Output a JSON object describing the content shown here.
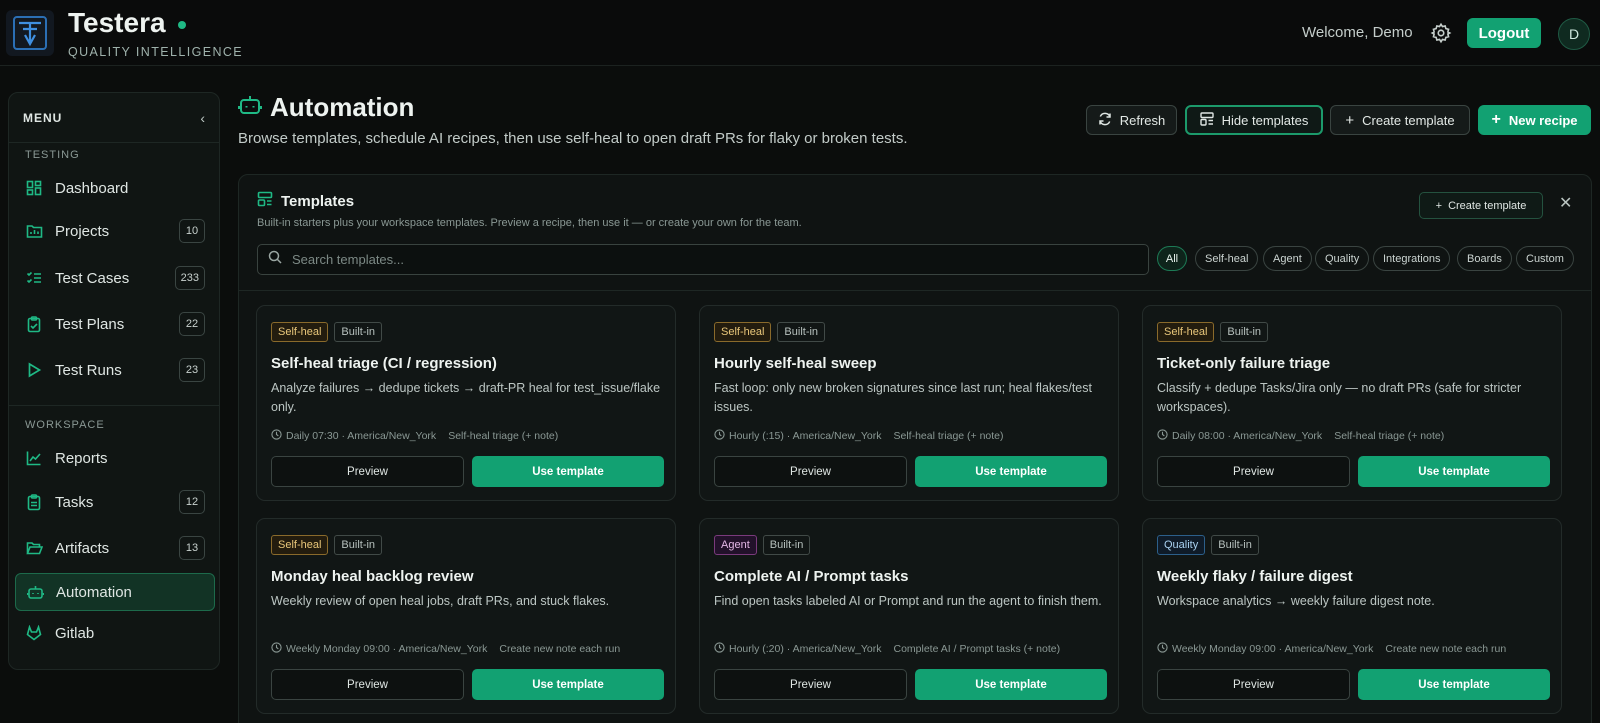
{
  "brand": {
    "name": "Testera",
    "subtitle": "QUALITY INTELLIGENCE"
  },
  "header": {
    "welcome": "Welcome, Demo",
    "logout": "Logout",
    "avatar": "D"
  },
  "sidebar": {
    "menu_label": "MENU",
    "sections": [
      {
        "label": "TESTING"
      },
      {
        "label": "WORKSPACE"
      }
    ],
    "items": [
      {
        "label": "Dashboard",
        "icon": "dashboard-icon"
      },
      {
        "label": "Projects",
        "count": "10",
        "icon": "folder-chart-icon"
      },
      {
        "label": "Test Cases",
        "count": "233",
        "icon": "list-check-icon"
      },
      {
        "label": "Test Plans",
        "count": "22",
        "icon": "clipboard-check-icon"
      },
      {
        "label": "Test Runs",
        "count": "23",
        "icon": "play-icon"
      },
      {
        "label": "Reports",
        "icon": "line-chart-icon"
      },
      {
        "label": "Tasks",
        "count": "12",
        "icon": "clipboard-icon"
      },
      {
        "label": "Artifacts",
        "count": "13",
        "icon": "folder-open-icon"
      },
      {
        "label": "Automation",
        "icon": "bot-icon",
        "active": true
      },
      {
        "label": "Gitlab",
        "icon": "gitlab-icon"
      }
    ]
  },
  "page": {
    "title": "Automation",
    "description": "Browse templates, schedule AI recipes, then use self-heal to open draft PRs for flaky or broken tests.",
    "actions": {
      "refresh": "Refresh",
      "hide_templates": "Hide templates",
      "create_template": "Create template",
      "new_recipe": "New recipe"
    }
  },
  "templates": {
    "title": "Templates",
    "description": "Built-in starters plus your workspace templates. Preview a recipe, then use it — or create your own for the team.",
    "create_button": "Create template",
    "search_placeholder": "Search templates...",
    "filters": [
      "All",
      "Self-heal",
      "Agent",
      "Quality",
      "Integrations",
      "Boards",
      "Custom"
    ],
    "active_filter": "All",
    "preview_label": "Preview",
    "use_label": "Use template",
    "cards": [
      {
        "category": "Self-heal",
        "origin": "Built-in",
        "title": "Self-heal triage (CI / regression)",
        "description": "Analyze failures → dedupe tickets → draft-PR heal for test_issue/flake only.",
        "schedule": "Daily 07:30 · America/New_York",
        "output": "Self-heal triage (+ note)"
      },
      {
        "category": "Self-heal",
        "origin": "Built-in",
        "title": "Hourly self-heal sweep",
        "description": "Fast loop: only new broken signatures since last run; heal flakes/test issues.",
        "schedule": "Hourly (:15) · America/New_York",
        "output": "Self-heal triage (+ note)"
      },
      {
        "category": "Self-heal",
        "origin": "Built-in",
        "title": "Ticket-only failure triage",
        "description": "Classify + dedupe Tasks/Jira only — no draft PRs (safe for stricter workspaces).",
        "schedule": "Daily 08:00 · America/New_York",
        "output": "Self-heal triage (+ note)"
      },
      {
        "category": "Self-heal",
        "origin": "Built-in",
        "title": "Monday heal backlog review",
        "description": "Weekly review of open heal jobs, draft PRs, and stuck flakes.",
        "schedule": "Weekly Monday 09:00 · America/New_York",
        "output": "Create new note each run"
      },
      {
        "category": "Agent",
        "origin": "Built-in",
        "title": "Complete AI / Prompt tasks",
        "description": "Find open tasks labeled AI or Prompt and run the agent to finish them.",
        "schedule": "Hourly (:20) · America/New_York",
        "output": "Complete AI / Prompt tasks (+ note)"
      },
      {
        "category": "Quality",
        "origin": "Built-in",
        "title": "Weekly flaky / failure digest",
        "description": "Workspace analytics → weekly failure digest note.",
        "schedule": "Weekly Monday 09:00 · America/New_York",
        "output": "Create new note each run"
      }
    ]
  },
  "colors": {
    "accent": "#12a172",
    "background": "#0b0d0c",
    "selfheal_tag": "#e9c77a",
    "agent_tag": "#e4b7e6",
    "quality_tag": "#a9d1f0"
  }
}
